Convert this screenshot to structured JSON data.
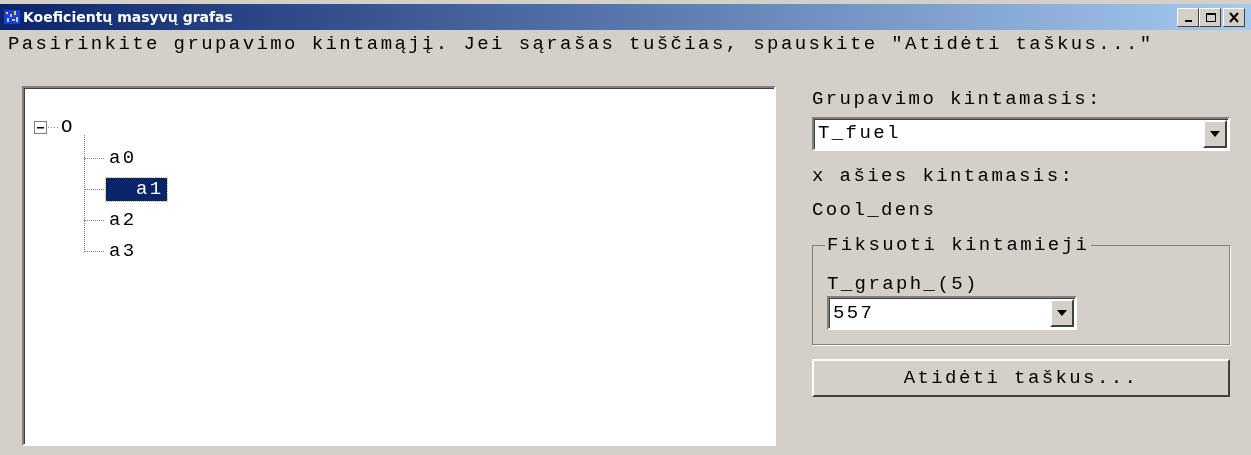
{
  "window": {
    "title": "Koeficientų masyvų grafas"
  },
  "instruction": "Pasirinkite grupavimo kintamąjį. Jei sąrašas tuščias, spauskite \"Atidėti taškus...\"",
  "tree": [
    {
      "label": "O",
      "expanded": true,
      "selected": false,
      "children": [
        {
          "label": "a0",
          "selected": false
        },
        {
          "label": "a1",
          "selected": true
        },
        {
          "label": "a2",
          "selected": false
        },
        {
          "label": "a3",
          "selected": false
        }
      ]
    }
  ],
  "grouping": {
    "label": "Grupavimo kintamasis:",
    "value": "T_fuel"
  },
  "x_axis": {
    "label": "x ašies kintamasis:",
    "value": "Cool_dens"
  },
  "fixed": {
    "title": "Fiksuoti kintamieji",
    "fields": [
      {
        "label": "T_graph_(5)",
        "value": "557"
      }
    ]
  },
  "button": "Atidėti taškus..."
}
